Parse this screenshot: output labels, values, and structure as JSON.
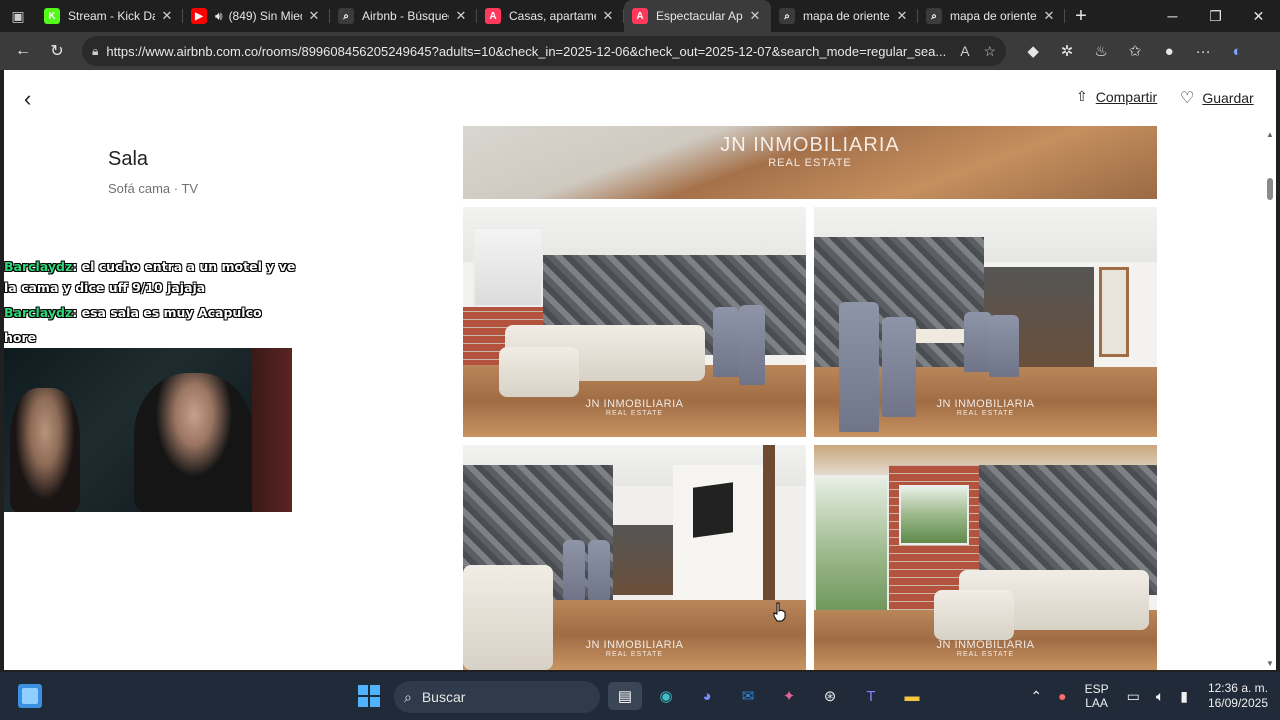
{
  "browser": {
    "tabs": [
      {
        "title": "Stream - Kick Dashboard",
        "favicon": "K",
        "favicon_color": "#53fc18",
        "active": false
      },
      {
        "title": "(849) Sin Miedo",
        "favicon": "▶",
        "favicon_color": "#ff0000",
        "active": false,
        "audio": true
      },
      {
        "title": "Airbnb - Búsqueda",
        "favicon": "⌕",
        "favicon_color": "#3b3b3b",
        "active": false
      },
      {
        "title": "Casas, apartamentos",
        "favicon": "A",
        "favicon_color": "#ff385c",
        "active": false
      },
      {
        "title": "Espectacular Apartamento",
        "favicon": "A",
        "favicon_color": "#ff385c",
        "active": true
      },
      {
        "title": "mapa de oriente a",
        "favicon": "⌕",
        "favicon_color": "#3b3b3b",
        "active": false
      },
      {
        "title": "mapa de oriente a",
        "favicon": "⌕",
        "favicon_color": "#3b3b3b",
        "active": false
      }
    ],
    "url": "https://www.airbnb.com.co/rooms/899608456205249645?adults=10&check_in=2025-12-06&check_out=2025-12-07&search_mode=regular_sea..."
  },
  "page": {
    "share_label": "Compartir",
    "save_label": "Guardar",
    "room_title": "Sala",
    "room_subtitle": "Sofá cama · TV",
    "watermark_main": "JN INMOBILIARIA",
    "watermark_sub": "REAL ESTATE"
  },
  "chat": [
    {
      "user": "Barclaydz",
      "text": ": el cucho entra a un motel y ve la cama y dice uff 9/10 jajaja"
    },
    {
      "user": "Barclaydz",
      "text": ": esa sala es muy Acapulco"
    },
    {
      "user": "",
      "text": "hore"
    }
  ],
  "taskbar": {
    "search_label": "Buscar",
    "lang_1": "ESP",
    "lang_2": "LAA",
    "time": "12:36 a. m.",
    "date": "16/09/2025"
  }
}
